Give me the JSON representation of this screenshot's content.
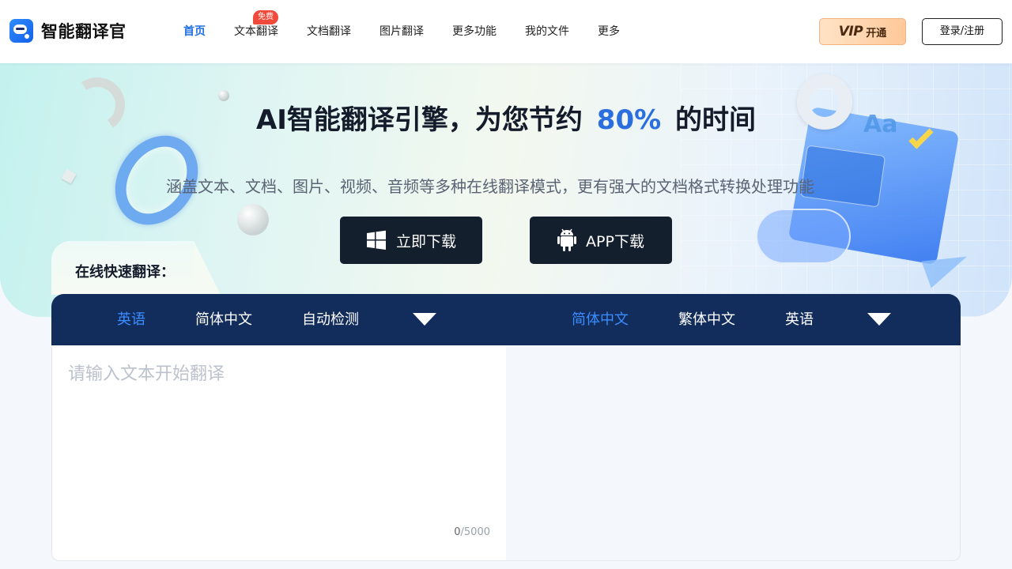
{
  "header": {
    "logo_text": "智能翻译官",
    "nav": [
      {
        "label": "首页",
        "active": true
      },
      {
        "label": "文本翻译",
        "badge": "免费"
      },
      {
        "label": "文档翻译"
      },
      {
        "label": "图片翻译"
      },
      {
        "label": "更多功能"
      },
      {
        "label": "我的文件"
      },
      {
        "label": "更多"
      }
    ],
    "vip": {
      "label": "VIP",
      "action": "开通"
    },
    "login_label": "登录/注册"
  },
  "hero": {
    "title_prefix": "AI智能翻译引擎，为您节约",
    "title_highlight": "80%",
    "title_suffix": "的时间",
    "subtitle": "涵盖文本、文档、图片、视频、音频等多种在线翻译模式，更有强大的文档格式转换处理功能",
    "buttons": {
      "download_label": "立即下载",
      "app_label": "APP下载"
    },
    "highlight_color": "#2b6fdf"
  },
  "translator": {
    "section_label": "在线快速翻译：",
    "source_langs": [
      "英语",
      "简体中文",
      "自动检测"
    ],
    "source_active": "英语",
    "target_langs": [
      "简体中文",
      "繁体中文",
      "英语"
    ],
    "target_active": "简体中文",
    "input_placeholder": "请输入文本开始翻译",
    "char_count": "0",
    "char_limit": "/5000"
  },
  "colors": {
    "accent": "#1f6fe0",
    "bar_bg": "#122d5c",
    "button_dark": "#141f2e",
    "badge_red": "#f04a3a"
  },
  "icons": {
    "download": "windows-icon",
    "app": "android-icon",
    "dropdown": "caret-down-icon"
  }
}
